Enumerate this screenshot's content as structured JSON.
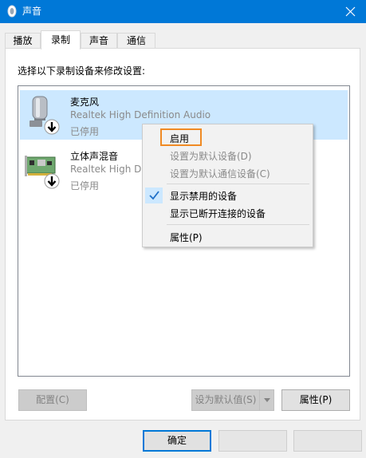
{
  "window": {
    "title": "声音",
    "app_icon": "speaker-icon",
    "close_icon": "close-icon"
  },
  "tabs": [
    {
      "label": "播放"
    },
    {
      "label": "录制"
    },
    {
      "label": "声音"
    },
    {
      "label": "通信"
    }
  ],
  "panel": {
    "instruction": "选择以下录制设备来修改设置:",
    "devices": [
      {
        "name": "麦克风",
        "driver": "Realtek High Definition Audio",
        "status": "已停用",
        "icon": "microphone-icon",
        "selected": true
      },
      {
        "name": "立体声混音",
        "driver": "Realtek High De",
        "status": "已停用",
        "icon": "sound-card-icon",
        "selected": false
      }
    ],
    "buttons": {
      "configure": "配置(C)",
      "set_default": "设为默认值(S)",
      "properties": "属性(P)"
    }
  },
  "context_menu": {
    "items": [
      {
        "label": "启用",
        "enabled": true,
        "highlighted": true
      },
      {
        "label": "设置为默认设备(D)",
        "enabled": false
      },
      {
        "label": "设置为默认通信设备(C)",
        "enabled": false
      },
      {
        "label": "显示禁用的设备",
        "enabled": true,
        "checked": true
      },
      {
        "label": "显示已断开连接的设备",
        "enabled": true
      },
      {
        "label": "属性(P)",
        "enabled": true
      }
    ],
    "highlight_color": "#f08a24"
  },
  "footer": {
    "ok": "确定",
    "cancel": "",
    "apply": ""
  },
  "colors": {
    "titlebar": "#0078d7",
    "selection": "#cce8ff",
    "accent": "#0078d7"
  }
}
